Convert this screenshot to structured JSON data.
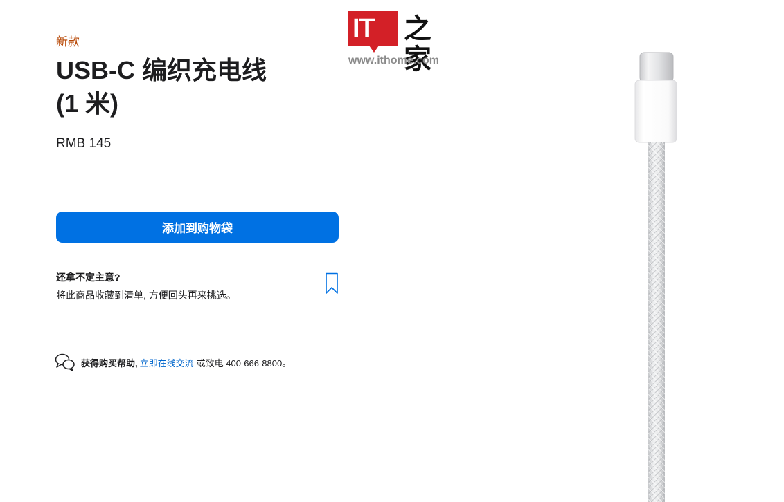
{
  "product": {
    "badge": "新款",
    "title_line1": "USB-C 编织充电线",
    "title_line2": "(1 米)",
    "price": "RMB 145",
    "add_to_bag_label": "添加到购物袋"
  },
  "save_for_later": {
    "question": "还拿不定主意?",
    "description": "将此商品收藏到清单, 方便回头再来挑选。",
    "icon": "bookmark-icon"
  },
  "help": {
    "icon": "chat-bubbles-icon",
    "label": "获得购买帮助,",
    "link_text": "立即在线交流",
    "phone_text": "或致电 400-666-8800。"
  },
  "watermark": {
    "logo_letters": "IT",
    "logo_chinese": "之家",
    "url": "www.ithome.com"
  },
  "colors": {
    "accent_blue": "#0071e3",
    "link_blue": "#0066cc",
    "badge_orange": "#b64400",
    "watermark_red": "#d32027"
  }
}
